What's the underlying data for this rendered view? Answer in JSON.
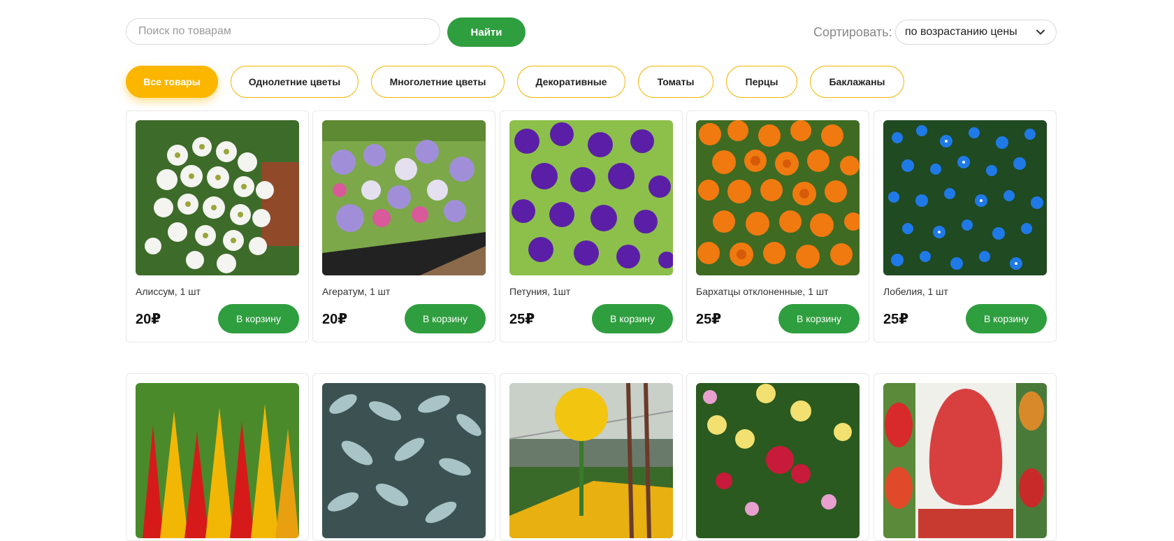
{
  "search": {
    "placeholder": "Поиск по товарам",
    "value": "",
    "button_label": "Найти"
  },
  "sort": {
    "label": "Сортировать:",
    "selected": "по возрастанию цены"
  },
  "categories": [
    {
      "label": "Все товары",
      "active": true
    },
    {
      "label": "Однолетние цветы",
      "active": false
    },
    {
      "label": "Многолетние цветы",
      "active": false
    },
    {
      "label": "Декоративные",
      "active": false
    },
    {
      "label": "Томаты",
      "active": false
    },
    {
      "label": "Перцы",
      "active": false
    },
    {
      "label": "Баклажаны",
      "active": false
    }
  ],
  "products": [
    {
      "title": "Алиссум, 1 шт",
      "price": "20₽",
      "cart_label": "В корзину"
    },
    {
      "title": "Агератум, 1 шт",
      "price": "20₽",
      "cart_label": "В корзину"
    },
    {
      "title": "Петуния, 1шт",
      "price": "25₽",
      "cart_label": "В корзину"
    },
    {
      "title": "Бархатцы отклоненные, 1 шт",
      "price": "25₽",
      "cart_label": "В корзину"
    },
    {
      "title": "Лобелия, 1 шт",
      "price": "25₽",
      "cart_label": "В корзину"
    }
  ],
  "colors": {
    "accent_green": "#2e9e3e",
    "accent_yellow": "#fcb600"
  }
}
